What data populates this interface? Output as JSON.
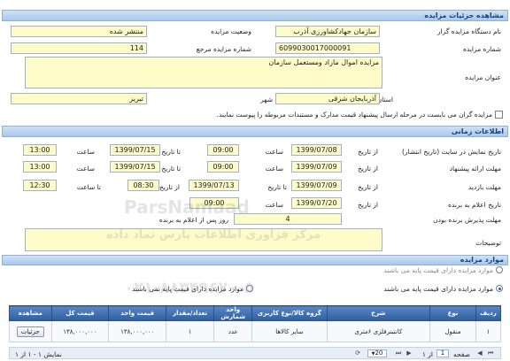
{
  "details": {
    "header": "مشاهده جزئیات مزایده",
    "org_label": "نام دستگاه مزایده گزار",
    "org_value": "سازمان جهادکشاورزی آذرب",
    "status_label": "وضعیت مزایده",
    "status_value": "منتشر شده",
    "number_label": "شماره مزایده",
    "number_value": "6099030017000091",
    "ref_label": "شماره مزایده مرجع",
    "ref_value": "114",
    "title_label": "عنوان مزایده",
    "title_value": "مزایده اموال مازاد ومستعمل سازمان",
    "province_label": "استان",
    "province_value": "آذربایجان شرقی",
    "city_label": "شهر",
    "city_value": "تبریز",
    "notice": "مزایده گران می بایست در مرحله ارسال پیشنهاد قیمت مدارک و مستندات مربوطه را پیوست نمایند."
  },
  "timing": {
    "header": "اطلاعات زمانی",
    "from_date": "از تاریخ",
    "to_date": "تا تاریخ",
    "time": "ساعت",
    "to_time": "تا ساعت",
    "publish_label": "تاریخ نمایش در سایت (تاریخ انتشار)",
    "publish_from_date": "1399/07/08",
    "publish_from_time": "09:00",
    "publish_to_date": "1399/07/15",
    "publish_to_time": "13:00",
    "offer_label": "مهلت ارائه پیشنهاد",
    "offer_from_date": "1399/07/09",
    "offer_from_time": "09:00",
    "offer_to_date": "1399/07/15",
    "offer_to_time": "13:00",
    "visit_label": "مهلت بازدید",
    "visit_from_date": "1399/07/09",
    "visit_to_date": "1399/07/13",
    "visit_from_time": "08:30",
    "visit_to_time": "12:30",
    "announce_label": "تاریخ اعلام به برنده",
    "announce_date": "1399/07/20",
    "announce_time": "09:00",
    "accept_label": "مهلت پذیرش برنده بودن",
    "accept_value": "4",
    "accept_suffix": "روز پس از اعلام به برنده",
    "desc_label": "توضیحات"
  },
  "items": {
    "header": "موارد مزایده",
    "radio_no_base": "موارد مزایده دارای قیمت پایه نمی باشند",
    "radio_with_base": "موارد مزایده دارای قیمت پایه می باشند",
    "columns": [
      "ردیف",
      "نوع",
      "شرح",
      "گروه کالا/نوع کاربری",
      "واحد شمارش",
      "تعداد/مقدار",
      "قیمت واحد",
      "قیمت کل",
      "مشاهده"
    ],
    "rows": [
      [
        "۱",
        "منقول",
        "کانتینرفلزی ۶متری",
        "سایر کالاها",
        "عدد",
        "۱",
        "۱۳۸,۰۰۰,۰۰۰",
        "۱۳۸,۰۰۰,۰۰۰",
        "جزئیات"
      ]
    ],
    "pager": {
      "page_word": "صفحه",
      "page_value": "1",
      "of_text": "از ۱",
      "page_size": "20",
      "summary": "نمایش ۱ - ۱ از ۱"
    }
  },
  "watermark": {
    "brand": "ParsNamaad",
    "line1": "مرکز فراوری اطلاعات پارس نماد داده",
    "phone": "۰۲۱-۸۸۳۴۹۶۷۰-۵"
  }
}
